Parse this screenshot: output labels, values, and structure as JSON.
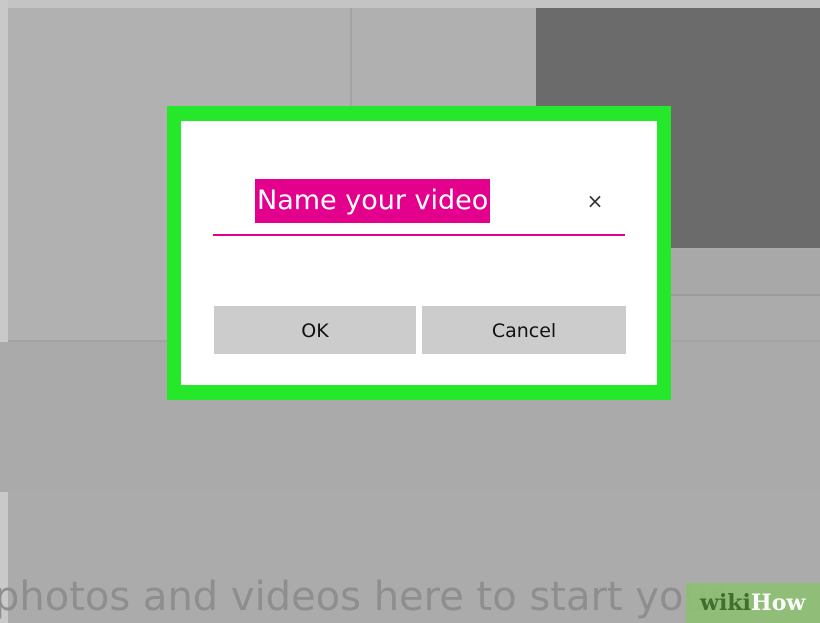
{
  "dialog": {
    "name_value": "Name your video",
    "clear_glyph": "×",
    "ok_label": "OK",
    "cancel_label": "Cancel"
  },
  "background": {
    "empty_prompt": "photos and videos here to start your"
  },
  "watermark": {
    "wiki": "wiki",
    "how": "How"
  },
  "colors": {
    "accent": "#e3008c",
    "highlight_frame": "#25e82a",
    "button_bg": "#cccccc",
    "watermark_bg": "#8fbf76"
  },
  "icons": {
    "clear": "close-icon"
  }
}
